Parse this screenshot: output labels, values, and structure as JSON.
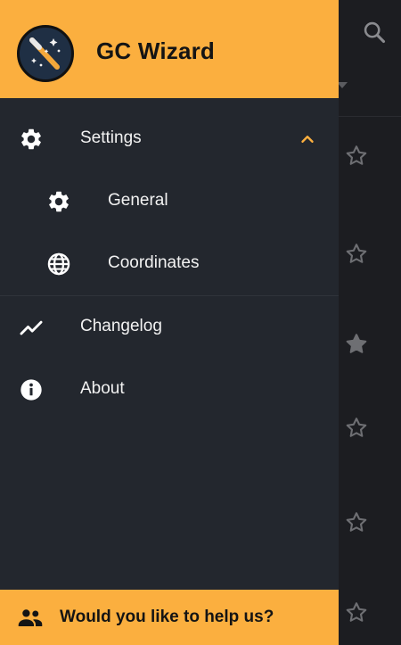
{
  "header": {
    "app_title": "GC Wizard",
    "logo_icon": "wizard-wand-logo-icon",
    "accent_color": "#fbaf3f"
  },
  "menu": {
    "settings": {
      "label": "Settings",
      "icon": "gear-icon",
      "expanded": true
    },
    "general": {
      "label": "General",
      "icon": "gear-icon"
    },
    "coordinates": {
      "label": "Coordinates",
      "icon": "globe-icon"
    },
    "changelog": {
      "label": "Changelog",
      "icon": "trend-line-icon"
    },
    "about": {
      "label": "About",
      "icon": "info-icon"
    }
  },
  "footer": {
    "label": "Would you like to help us?",
    "icon": "people-icon"
  },
  "background_list": {
    "search_icon": "search-icon",
    "stars": [
      "star-outline",
      "star-outline",
      "star-filled",
      "star-outline",
      "star-outline",
      "star-outline"
    ]
  }
}
